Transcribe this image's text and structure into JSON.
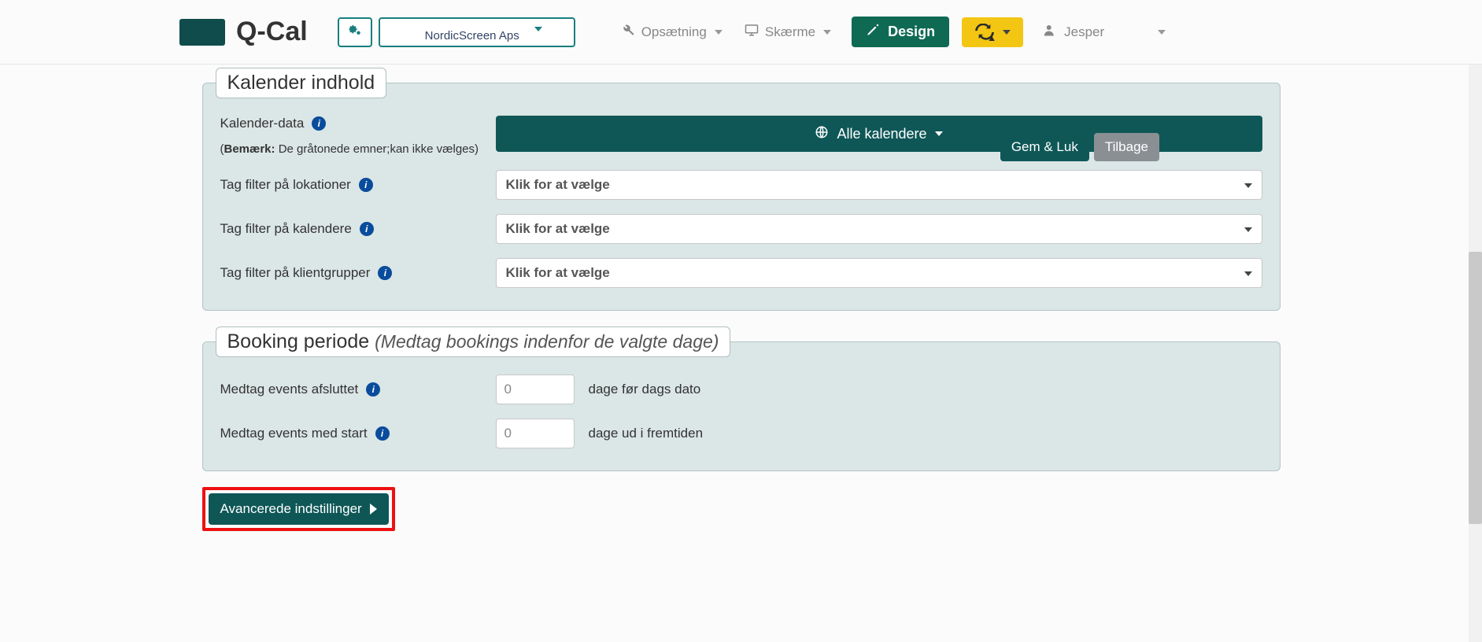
{
  "brand": "Q-Cal",
  "nav": {
    "org_selected": "NordicScreen Aps",
    "setup": "Opsætning",
    "screens": "Skærme",
    "design": "Design",
    "user": "Jesper"
  },
  "float": {
    "save": "Gem & Luk",
    "back": "Tilbage"
  },
  "calendar_panel": {
    "legend": "Kalender indhold",
    "data_label": "Kalender-data",
    "note_bold": "Bemærk:",
    "note_rest": " De gråtonede emner;kan ikke vælges)",
    "all_calendars": "Alle kalendere",
    "loc_label": "Tag filter på lokationer",
    "cal_label": "Tag filter på kalendere",
    "grp_label": "Tag filter på klientgrupper",
    "select_placeholder": "Klik for at vælge"
  },
  "booking_panel": {
    "legend_main": "Booking periode ",
    "legend_sub": "(Medtag bookings indenfor de valgte dage)",
    "end_label": "Medtag events afsluttet",
    "start_label": "Medtag events med start",
    "end_suffix": "dage før dags dato",
    "start_suffix": "dage ud i fremtiden",
    "end_value": "0",
    "start_value": "0"
  },
  "advanced": "Avancerede indstillinger"
}
